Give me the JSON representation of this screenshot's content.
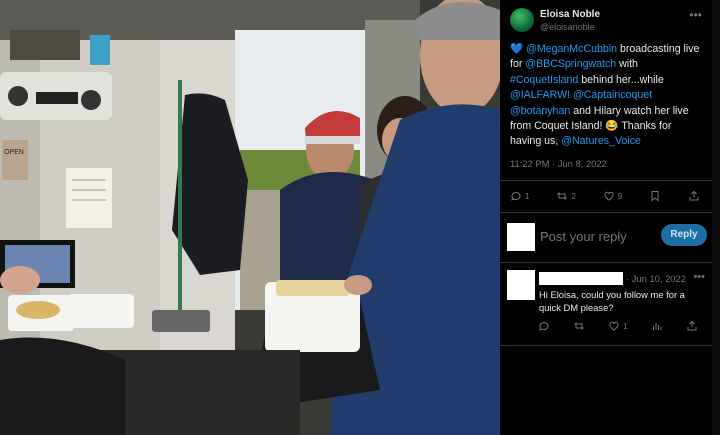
{
  "post": {
    "author_name": "Eloisa Noble",
    "author_handle": "@eloisanoble",
    "more_icon": "•••",
    "heart_icon": "💙",
    "text_parts": [
      {
        "t": " ",
        "link": false
      },
      {
        "t": "@MeganMcCubbin",
        "link": true
      },
      {
        "t": " broadcasting live for ",
        "link": false
      },
      {
        "t": "@BBCSpringwatch",
        "link": true
      },
      {
        "t": " with ",
        "link": false
      },
      {
        "t": "#CoquetIsland",
        "link": true
      },
      {
        "t": " behind her...while ",
        "link": false
      },
      {
        "t": "@IALFARW!",
        "link": true
      },
      {
        "t": " ",
        "link": false
      },
      {
        "t": "@Captaincoquet",
        "link": true
      },
      {
        "t": " ",
        "link": false
      },
      {
        "t": "@botanyhan",
        "link": true
      },
      {
        "t": " and Hilary watch her live from Coquet Island! 😂 Thanks for having us, ",
        "link": false
      },
      {
        "t": "@Natures_Voice",
        "link": true
      }
    ],
    "timestamp": "11:22 PM · Jun 8, 2022",
    "actions": {
      "reply_count": "1",
      "retweet_count": "2",
      "like_count": "9"
    }
  },
  "reply_composer": {
    "placeholder": "Post your reply",
    "button_label": "Reply"
  },
  "comment": {
    "date": "· Jun 10, 2022",
    "more_icon": "•••",
    "text": "Hi Eloisa, could you follow me for a quick DM please?",
    "actions": {
      "like_count": "1"
    }
  },
  "photo": {
    "sign_text": "OPEN",
    "icons": [
      "reply-icon",
      "retweet-icon",
      "like-icon",
      "bookmark-icon",
      "share-icon",
      "views-icon"
    ]
  }
}
